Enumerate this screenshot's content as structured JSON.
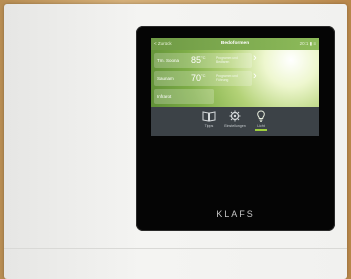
{
  "device": {
    "brand": "KLAFS"
  },
  "screen": {
    "header": {
      "back_label": "< Zurück",
      "title": "Bedoformen",
      "status": "20:1 ▮ ≡"
    },
    "rows": [
      {
        "label": "Tm. Soona",
        "value": "85",
        "unit": "°C",
        "desc": "Programm und Bedfaren"
      },
      {
        "label": "Saunam",
        "value": "70",
        "unit": "°C",
        "desc": "Programm und Führung"
      },
      {
        "label": "Infrarot",
        "value": "",
        "unit": "",
        "desc": ""
      }
    ],
    "toolbar": [
      {
        "label": "Tipps",
        "icon": "book-icon",
        "active": false
      },
      {
        "label": "Einstellungen",
        "icon": "gear-icon",
        "active": false
      },
      {
        "label": "Licht",
        "icon": "lightbulb-icon",
        "active": true
      }
    ],
    "colors": {
      "accent": "#9fd03c",
      "toolbar": "#3c4247",
      "header": "#7aa84c"
    }
  }
}
